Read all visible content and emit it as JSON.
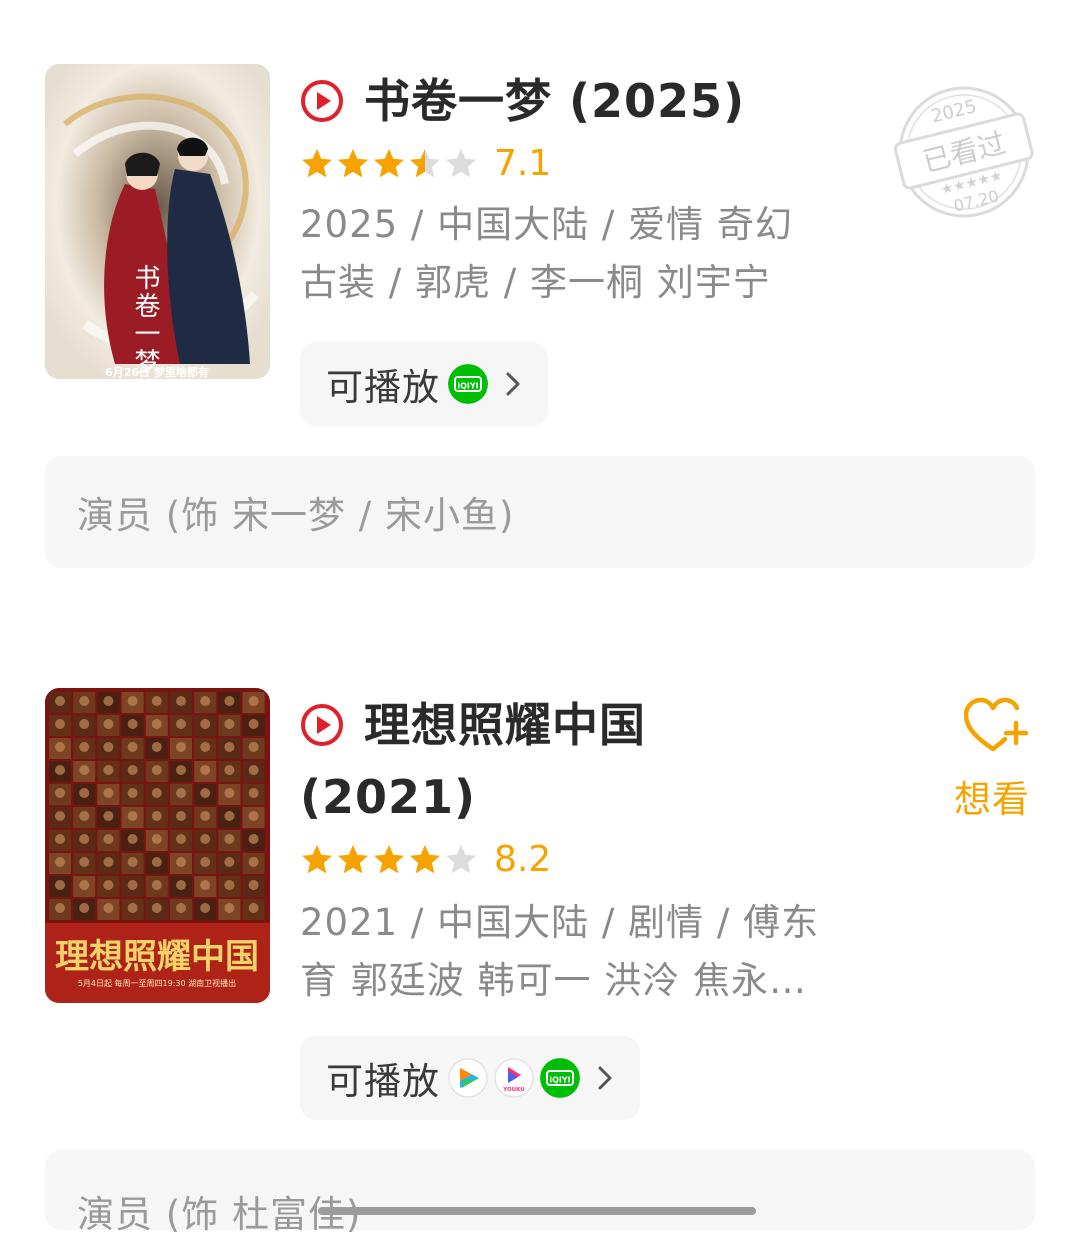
{
  "colors": {
    "accent_orange": "#f6a300",
    "play_red": "#e0202a",
    "star_empty": "#dcdcdc",
    "iqiyi_green": "#00be06"
  },
  "items": [
    {
      "title": "书卷一梦 (2025)",
      "title_line2": "",
      "rating_stars": 3.5,
      "score": "7.1",
      "meta_line1": "2025 / 中国大陆 / 爱情 奇幻",
      "meta_line2": "古装 / 郭虎 / 李一桐 刘宇宁",
      "play_label": "可播放",
      "platform_icons": [
        "iqiyi-icon"
      ],
      "cast_text": "演员 (饰 宋一梦 / 宋小鱼)",
      "poster_text": "书卷一梦",
      "poster_bottom_text": "6月26日 梦里啥都有",
      "stamp": {
        "year": "2025",
        "label": "已看过",
        "date": "07.20"
      }
    },
    {
      "title": "理想照耀中国",
      "title_line2": "(2021)",
      "rating_stars": 4,
      "score": "8.2",
      "meta_line1": "2021 / 中国大陆 / 剧情 / 傅东",
      "meta_line2": "育 郭廷波 韩可一 洪泠 焦永…",
      "play_label": "可播放",
      "platform_icons": [
        "tencent-video-icon",
        "youku-icon",
        "iqiyi-icon"
      ],
      "cast_text": "演员 (饰 杜富佳)",
      "poster_text": "理想照耀中国",
      "poster_bottom_text": "5月4日起 每周一至周四19:30 湖南卫视播出",
      "want_label": "想看"
    }
  ],
  "platform_text": {
    "iqiyi": "iQIYI",
    "youku": "YOUKU"
  }
}
